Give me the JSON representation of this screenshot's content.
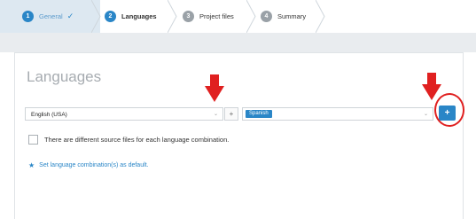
{
  "wizard": {
    "steps": [
      {
        "number": "1",
        "label": "General",
        "state": "done",
        "check_icon": "checkmark-icon"
      },
      {
        "number": "2",
        "label": "Languages",
        "state": "active"
      },
      {
        "number": "3",
        "label": "Project files",
        "state": "inactive"
      },
      {
        "number": "4",
        "label": "Summary",
        "state": "inactive"
      }
    ]
  },
  "panel": {
    "title": "Languages",
    "source_language": "English (USA)",
    "separator": "+",
    "target_languages": [
      "Spanish"
    ],
    "add_button": "+",
    "checkbox_label": "There are different source files for each language combination.",
    "checkbox_checked": false,
    "default_link": "Set language combination(s) as default."
  },
  "colors": {
    "accent": "#2a86c7",
    "annotation_red": "#e02020"
  },
  "annotations": [
    "red-arrow-icon",
    "red-arrow-icon",
    "red-circle-highlight"
  ]
}
